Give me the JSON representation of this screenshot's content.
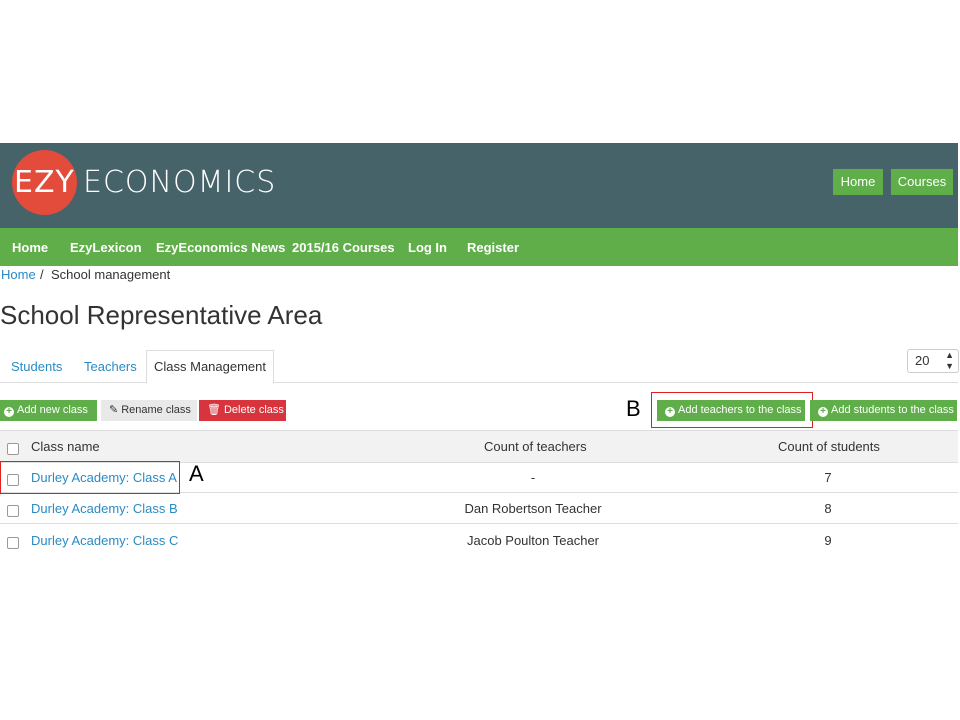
{
  "brand": {
    "prefix": "EZY",
    "name": "ECONOMICS",
    "logo_color": "#e34b3a"
  },
  "header": {
    "buttons": [
      "Home",
      "Courses"
    ]
  },
  "nav": {
    "items": [
      "Home",
      "EzyLexicon",
      "EzyEconomics News",
      "2015/16 Courses",
      "Log In",
      "Register"
    ]
  },
  "breadcrumb": {
    "home": "Home",
    "separator": "/",
    "current": "School management"
  },
  "page": {
    "title": "School Representative Area"
  },
  "tabs": {
    "items": [
      "Students",
      "Teachers",
      "Class Management"
    ],
    "active": "Class Management"
  },
  "page_size": {
    "value": "20"
  },
  "actions": {
    "add_class": "Add new class",
    "rename_class": "Rename class",
    "delete_class": "Delete class",
    "add_teachers": "Add teachers to the class",
    "add_students": "Add students to the class"
  },
  "annotations": {
    "a": "A",
    "b": "B"
  },
  "table": {
    "headers": [
      "Class name",
      "Count of teachers",
      "Count of students"
    ],
    "rows": [
      {
        "name": "Durley Academy: Class A",
        "teachers": "-",
        "students": "7"
      },
      {
        "name": "Durley Academy: Class B",
        "teachers": "Dan Robertson Teacher",
        "students": "8"
      },
      {
        "name": "Durley Academy: Class C",
        "teachers": "Jacob Poulton Teacher",
        "students": "9"
      }
    ]
  },
  "colors": {
    "header": "#47636a",
    "accent": "#5fae4a",
    "link": "#2a8bc4",
    "danger": "#d8343d"
  }
}
